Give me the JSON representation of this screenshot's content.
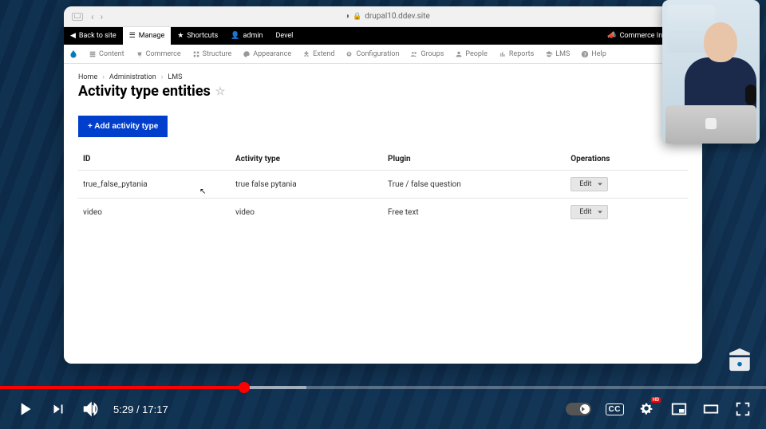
{
  "browser": {
    "url": "drupal10.ddev.site",
    "back_enabled": true,
    "forward_enabled": true
  },
  "admin_bar": {
    "back_to_site": "Back to site",
    "manage": "Manage",
    "shortcuts": "Shortcuts",
    "admin": "admin",
    "devel": "Devel",
    "commerce_inbox": "Commerce Inbox"
  },
  "toolbar": {
    "items": [
      {
        "label": "Content"
      },
      {
        "label": "Commerce"
      },
      {
        "label": "Structure"
      },
      {
        "label": "Appearance"
      },
      {
        "label": "Extend"
      },
      {
        "label": "Configuration"
      },
      {
        "label": "Groups"
      },
      {
        "label": "People"
      },
      {
        "label": "Reports"
      },
      {
        "label": "LMS"
      },
      {
        "label": "Help"
      }
    ]
  },
  "breadcrumb": {
    "home": "Home",
    "admin": "Administration",
    "lms": "LMS"
  },
  "page": {
    "title": "Activity type entities",
    "add_button": "+ Add activity type"
  },
  "table": {
    "headers": {
      "id": "ID",
      "type": "Activity type",
      "plugin": "Plugin",
      "ops": "Operations"
    },
    "rows": [
      {
        "id": "true_false_pytania",
        "type": "true false pytania",
        "plugin": "True / false question",
        "op": "Edit"
      },
      {
        "id": "video",
        "type": "video",
        "plugin": "Free text",
        "op": "Edit"
      }
    ]
  },
  "player": {
    "current_time": "5:29",
    "duration": "17:17",
    "cc_label": "CC",
    "hd_label": "HD"
  }
}
